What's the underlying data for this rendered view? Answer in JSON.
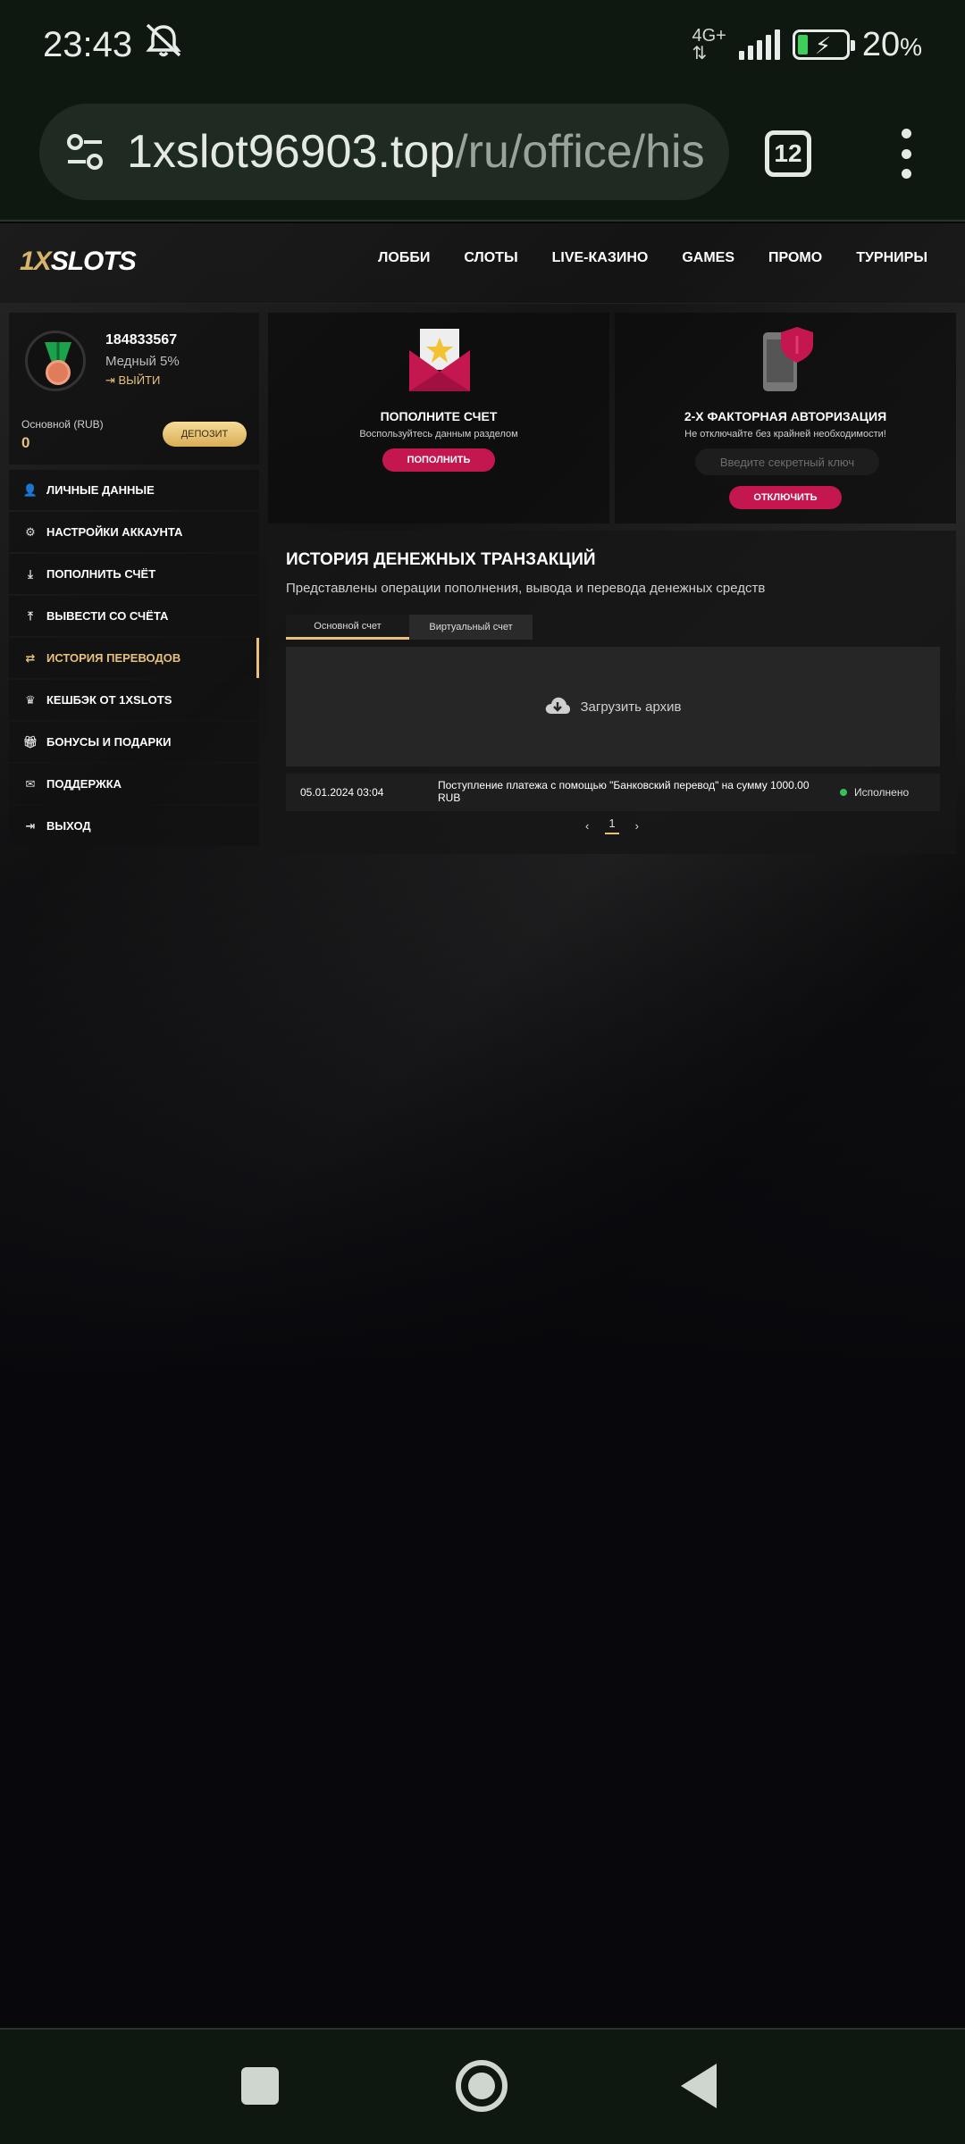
{
  "status_bar": {
    "time": "23:43",
    "network": "4G+",
    "battery": "20",
    "battery_unit": "%"
  },
  "browser": {
    "url_host": "1xslot96903.top",
    "url_path": "/ru/office/his",
    "tab_count": "12"
  },
  "site": {
    "logo_prefix": "1X",
    "logo_rest": "SLOTS",
    "nav": [
      "ЛОББИ",
      "СЛОТЫ",
      "LIVE-КАЗИНО",
      "GAMES",
      "ПРОМО",
      "ТУРНИРЫ"
    ]
  },
  "profile": {
    "id": "184833567",
    "rank": "Медный 5%",
    "logout": "ВЫЙТИ",
    "account_label": "Основной (RUB)",
    "balance": "0",
    "deposit_button": "ДЕПОЗИТ"
  },
  "side_menu": [
    {
      "label": "ЛИЧНЫЕ ДАННЫЕ",
      "icon": "user-plus-icon"
    },
    {
      "label": "НАСТРОЙКИ АККАУНТА",
      "icon": "gears-icon"
    },
    {
      "label": "ПОПОЛНИТЬ СЧЁТ",
      "icon": "download-icon"
    },
    {
      "label": "ВЫВЕСТИ СО СЧЁТА",
      "icon": "upload-icon"
    },
    {
      "label": "ИСТОРИЯ ПЕРЕВОДОВ",
      "icon": "transfer-icon",
      "active": true
    },
    {
      "label": "КЕШБЭК ОТ 1XSLOTS",
      "icon": "crown-icon"
    },
    {
      "label": "БОНУСЫ И ПОДАРКИ",
      "icon": "gift-icon"
    },
    {
      "label": "ПОДДЕРЖКА",
      "icon": "envelope-icon"
    },
    {
      "label": "ВЫХОД",
      "icon": "sign-out-icon"
    }
  ],
  "topup_card": {
    "title": "ПОПОЛНИТЕ СЧЕТ",
    "subtitle": "Воспользуйтесь данным разделом",
    "button": "ПОПОЛНИТЬ"
  },
  "twofa_card": {
    "title": "2-Х ФАКТОРНАЯ АВТОРИЗАЦИЯ",
    "subtitle": "Не отключайте без крайней необходимости!",
    "input_placeholder": "Введите секретный ключ",
    "button": "ОТКЛЮЧИТЬ"
  },
  "history": {
    "title": "ИСТОРИЯ ДЕНЕЖНЫХ ТРАНЗАКЦИЙ",
    "subtitle": "Представлены операции пополнения, вывода и перевода денежных средств",
    "tabs": [
      "Основной счет",
      "Виртуальный счет"
    ],
    "archive_label": "Загрузить архив",
    "transactions": [
      {
        "date": "05.01.2024 03:04",
        "description": "Поступление платежа с помощью \"Банковский перевод\" на сумму 1000.00 RUB",
        "status": "Исполнено"
      }
    ],
    "pager": {
      "prev": "‹",
      "current": "1",
      "next": "›"
    }
  }
}
